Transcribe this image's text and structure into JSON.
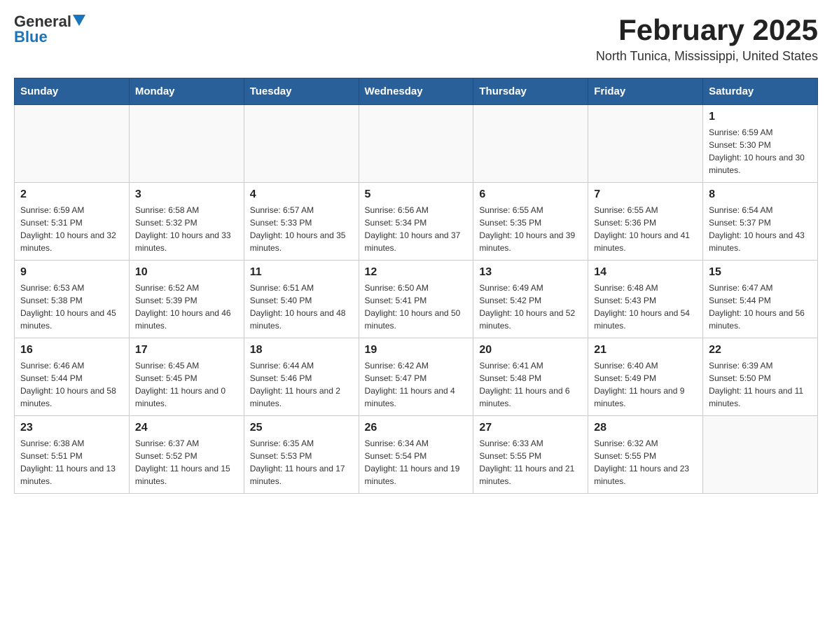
{
  "header": {
    "logo_general": "General",
    "logo_blue": "Blue",
    "month_title": "February 2025",
    "location": "North Tunica, Mississippi, United States"
  },
  "days_of_week": [
    "Sunday",
    "Monday",
    "Tuesday",
    "Wednesday",
    "Thursday",
    "Friday",
    "Saturday"
  ],
  "weeks": [
    [
      {
        "day": "",
        "info": ""
      },
      {
        "day": "",
        "info": ""
      },
      {
        "day": "",
        "info": ""
      },
      {
        "day": "",
        "info": ""
      },
      {
        "day": "",
        "info": ""
      },
      {
        "day": "",
        "info": ""
      },
      {
        "day": "1",
        "info": "Sunrise: 6:59 AM\nSunset: 5:30 PM\nDaylight: 10 hours and 30 minutes."
      }
    ],
    [
      {
        "day": "2",
        "info": "Sunrise: 6:59 AM\nSunset: 5:31 PM\nDaylight: 10 hours and 32 minutes."
      },
      {
        "day": "3",
        "info": "Sunrise: 6:58 AM\nSunset: 5:32 PM\nDaylight: 10 hours and 33 minutes."
      },
      {
        "day": "4",
        "info": "Sunrise: 6:57 AM\nSunset: 5:33 PM\nDaylight: 10 hours and 35 minutes."
      },
      {
        "day": "5",
        "info": "Sunrise: 6:56 AM\nSunset: 5:34 PM\nDaylight: 10 hours and 37 minutes."
      },
      {
        "day": "6",
        "info": "Sunrise: 6:55 AM\nSunset: 5:35 PM\nDaylight: 10 hours and 39 minutes."
      },
      {
        "day": "7",
        "info": "Sunrise: 6:55 AM\nSunset: 5:36 PM\nDaylight: 10 hours and 41 minutes."
      },
      {
        "day": "8",
        "info": "Sunrise: 6:54 AM\nSunset: 5:37 PM\nDaylight: 10 hours and 43 minutes."
      }
    ],
    [
      {
        "day": "9",
        "info": "Sunrise: 6:53 AM\nSunset: 5:38 PM\nDaylight: 10 hours and 45 minutes."
      },
      {
        "day": "10",
        "info": "Sunrise: 6:52 AM\nSunset: 5:39 PM\nDaylight: 10 hours and 46 minutes."
      },
      {
        "day": "11",
        "info": "Sunrise: 6:51 AM\nSunset: 5:40 PM\nDaylight: 10 hours and 48 minutes."
      },
      {
        "day": "12",
        "info": "Sunrise: 6:50 AM\nSunset: 5:41 PM\nDaylight: 10 hours and 50 minutes."
      },
      {
        "day": "13",
        "info": "Sunrise: 6:49 AM\nSunset: 5:42 PM\nDaylight: 10 hours and 52 minutes."
      },
      {
        "day": "14",
        "info": "Sunrise: 6:48 AM\nSunset: 5:43 PM\nDaylight: 10 hours and 54 minutes."
      },
      {
        "day": "15",
        "info": "Sunrise: 6:47 AM\nSunset: 5:44 PM\nDaylight: 10 hours and 56 minutes."
      }
    ],
    [
      {
        "day": "16",
        "info": "Sunrise: 6:46 AM\nSunset: 5:44 PM\nDaylight: 10 hours and 58 minutes."
      },
      {
        "day": "17",
        "info": "Sunrise: 6:45 AM\nSunset: 5:45 PM\nDaylight: 11 hours and 0 minutes."
      },
      {
        "day": "18",
        "info": "Sunrise: 6:44 AM\nSunset: 5:46 PM\nDaylight: 11 hours and 2 minutes."
      },
      {
        "day": "19",
        "info": "Sunrise: 6:42 AM\nSunset: 5:47 PM\nDaylight: 11 hours and 4 minutes."
      },
      {
        "day": "20",
        "info": "Sunrise: 6:41 AM\nSunset: 5:48 PM\nDaylight: 11 hours and 6 minutes."
      },
      {
        "day": "21",
        "info": "Sunrise: 6:40 AM\nSunset: 5:49 PM\nDaylight: 11 hours and 9 minutes."
      },
      {
        "day": "22",
        "info": "Sunrise: 6:39 AM\nSunset: 5:50 PM\nDaylight: 11 hours and 11 minutes."
      }
    ],
    [
      {
        "day": "23",
        "info": "Sunrise: 6:38 AM\nSunset: 5:51 PM\nDaylight: 11 hours and 13 minutes."
      },
      {
        "day": "24",
        "info": "Sunrise: 6:37 AM\nSunset: 5:52 PM\nDaylight: 11 hours and 15 minutes."
      },
      {
        "day": "25",
        "info": "Sunrise: 6:35 AM\nSunset: 5:53 PM\nDaylight: 11 hours and 17 minutes."
      },
      {
        "day": "26",
        "info": "Sunrise: 6:34 AM\nSunset: 5:54 PM\nDaylight: 11 hours and 19 minutes."
      },
      {
        "day": "27",
        "info": "Sunrise: 6:33 AM\nSunset: 5:55 PM\nDaylight: 11 hours and 21 minutes."
      },
      {
        "day": "28",
        "info": "Sunrise: 6:32 AM\nSunset: 5:55 PM\nDaylight: 11 hours and 23 minutes."
      },
      {
        "day": "",
        "info": ""
      }
    ]
  ]
}
